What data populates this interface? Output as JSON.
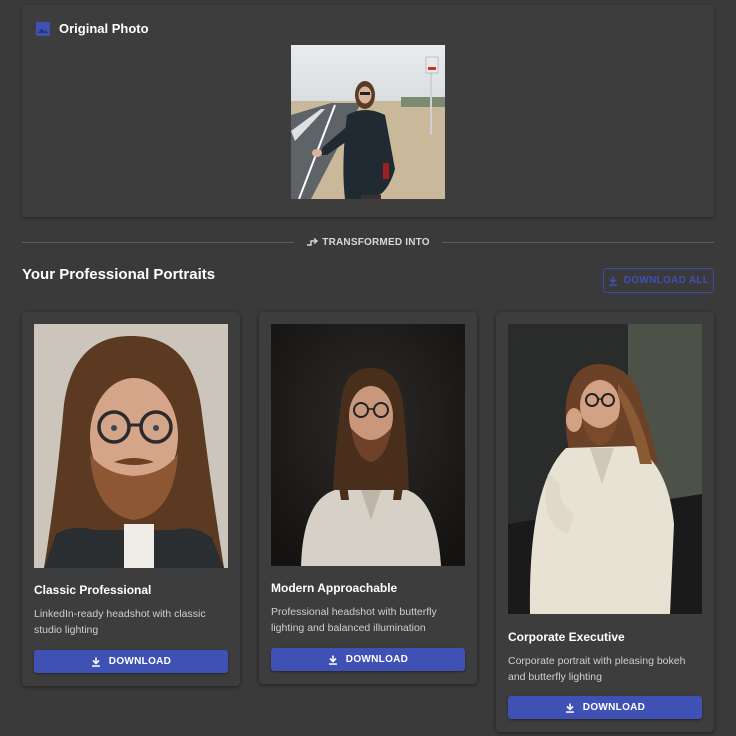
{
  "original": {
    "title": "Original Photo",
    "icon": "image-icon"
  },
  "divider": {
    "label": "TRANSFORMED INTO",
    "icon": "transform-icon"
  },
  "section": {
    "title": "Your Professional Portraits",
    "download_all_label": "DOWNLOAD ALL"
  },
  "portraits": [
    {
      "name": "Classic Professional",
      "description": "LinkedIn-ready headshot with classic studio lighting",
      "button_label": "DOWNLOAD"
    },
    {
      "name": "Modern Approachable",
      "description": "Professional headshot with butterfly lighting and balanced illumination",
      "button_label": "DOWNLOAD"
    },
    {
      "name": "Corporate Executive",
      "description": "Corporate portrait with pleasing bokeh and butterfly lighting",
      "button_label": "DOWNLOAD"
    }
  ],
  "colors": {
    "background": "#3a3a3a",
    "card": "#3d3d3d",
    "accent": "#3f51b5"
  }
}
